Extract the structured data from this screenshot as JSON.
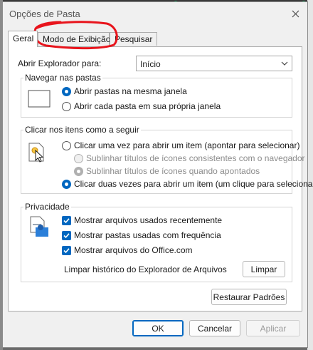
{
  "dialog": {
    "title": "Opções de Pasta",
    "close_icon": "close-icon"
  },
  "tabs": [
    {
      "label": "Geral",
      "active": true
    },
    {
      "label": "Modo de Exibição",
      "active": false
    },
    {
      "label": "Pesquisar",
      "active": false
    }
  ],
  "open_explorer": {
    "label": "Abrir Explorador para:",
    "value": "Início"
  },
  "browse": {
    "title": "Navegar nas pastas",
    "icon": "folder-window-icon",
    "options": [
      {
        "label": "Abrir pastas na mesma janela",
        "selected": true
      },
      {
        "label": "Abrir cada pasta em sua própria janela",
        "selected": false
      }
    ]
  },
  "click": {
    "title": "Clicar nos itens como a seguir",
    "icon": "click-pointer-icon",
    "single": {
      "label": "Clicar uma vez para abrir um item (apontar para selecionar)",
      "selected": false
    },
    "sub_options": [
      {
        "label": "Sublinhar títulos de ícones consistentes com o navegador",
        "selected": false
      },
      {
        "label": "Sublinhar títulos de ícones quando apontados",
        "selected": true
      }
    ],
    "double": {
      "label": "Clicar duas vezes para abrir um item (um clique para selecionar)",
      "selected": true
    }
  },
  "privacy": {
    "title": "Privacidade",
    "icon": "privacy-document-icon",
    "checks": [
      {
        "label": "Mostrar arquivos usados recentemente",
        "checked": true
      },
      {
        "label": "Mostrar pastas usadas com frequência",
        "checked": true
      },
      {
        "label": "Mostrar arquivos do Office.com",
        "checked": true
      }
    ],
    "clear_label": "Limpar histórico do Explorador de Arquivos",
    "clear_button": "Limpar"
  },
  "restore_button": "Restaurar Padrões",
  "footer": {
    "ok": "OK",
    "cancel": "Cancelar",
    "apply": "Aplicar"
  },
  "colors": {
    "accent": "#0067c0",
    "annotation": "#e8141c"
  }
}
